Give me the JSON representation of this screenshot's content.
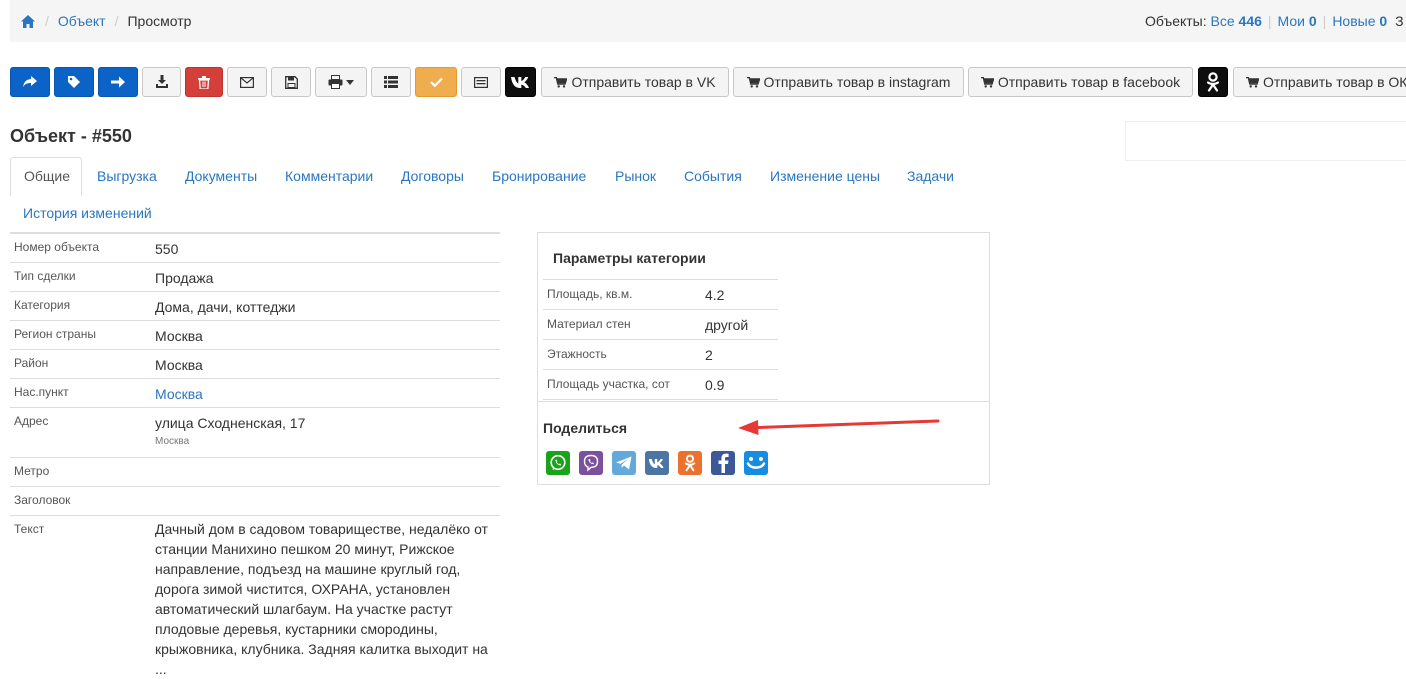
{
  "breadcrumb": {
    "items": [
      "Объект",
      "Просмотр"
    ]
  },
  "counters": {
    "label": "Объекты:",
    "all_label": "Все",
    "all_count": "446",
    "mine_label": "Мои",
    "mine_count": "0",
    "new_label": "Новые",
    "new_count": "0",
    "more": "З"
  },
  "toolbar": {
    "send_vk": "Отправить товар в VK",
    "send_instagram": "Отправить товар в instagram",
    "send_facebook": "Отправить товар в facebook",
    "send_ok": "Отправить товар в ОК"
  },
  "page_title": "Объект - #550",
  "tabs": [
    "Общие",
    "Выгрузка",
    "Документы",
    "Комментарии",
    "Договоры",
    "Бронирование",
    "Рынок",
    "События",
    "Изменение цены",
    "Задачи",
    "История изменений"
  ],
  "fields": [
    {
      "key": "Номер объекта",
      "value": "550"
    },
    {
      "key": "Тип сделки",
      "value": "Продажа"
    },
    {
      "key": "Категория",
      "value": "Дома, дачи, коттеджи"
    },
    {
      "key": "Регион страны",
      "value": "Москва"
    },
    {
      "key": "Район",
      "value": "Москва"
    },
    {
      "key": "Нас.пункт",
      "value": "Москва"
    },
    {
      "key": "Адрес",
      "value": "улица Сходненская, 17",
      "sub": "Москва"
    },
    {
      "key": "Метро",
      "value": ""
    },
    {
      "key": "Заголовок",
      "value": ""
    },
    {
      "key": "Текст",
      "value": "Дачный дом в садовом товариществе, недалёко от станции Манихино пешком 20 минут, Рижское направление, подъезд на машине круглый год, дорога зимой чистится, ОХРАНА, установлен автоматический шлагбаум. На участке растут плодовые деревья, кустарники смородины, крыжовника, клубника. Задняя калитка выходит на ..."
    }
  ],
  "category_params": {
    "title": "Параметры категории",
    "rows": [
      {
        "key": "Площадь, кв.м.",
        "value": "4.2"
      },
      {
        "key": "Материал стен",
        "value": "другой"
      },
      {
        "key": "Этажность",
        "value": "2"
      },
      {
        "key": "Площадь участка, сот",
        "value": "0.9"
      }
    ]
  },
  "share": {
    "title": "Поделиться",
    "icons": [
      "whatsapp-icon",
      "viber-icon",
      "telegram-icon",
      "vk-icon",
      "odnoklassniki-icon",
      "facebook-icon",
      "moimir-icon"
    ]
  },
  "colors": {
    "primary": "#0b63c7",
    "danger": "#d43f3a",
    "warning": "#f0ad4e",
    "link": "#2a76c0",
    "arrow": "#e53935"
  }
}
